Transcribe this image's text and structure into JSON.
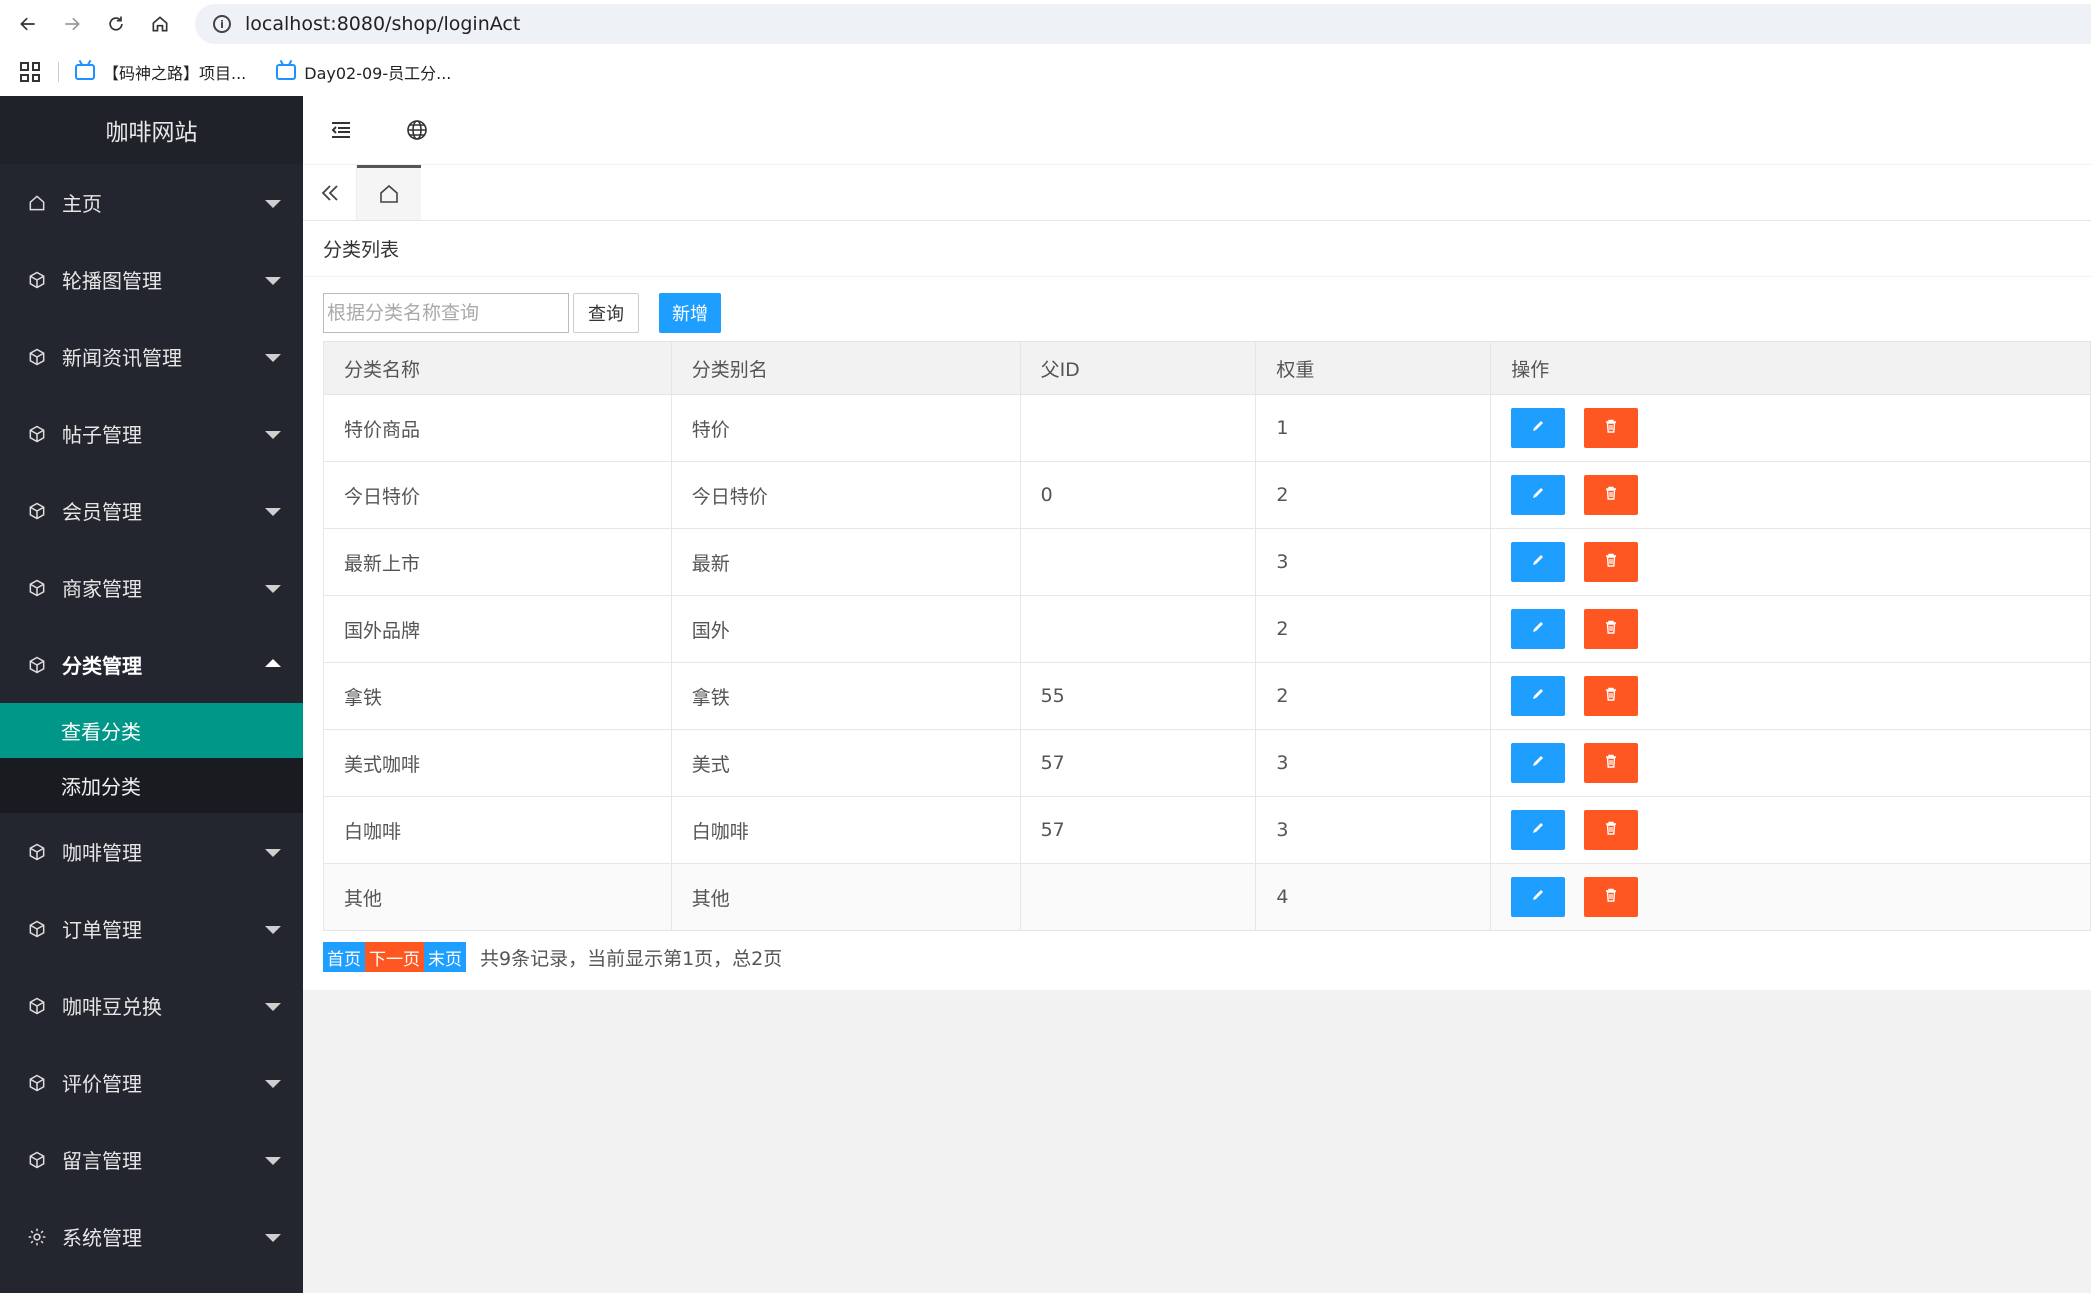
{
  "browser": {
    "url": "localhost:8080/shop/loginAct",
    "bookmarks": [
      "【码神之路】项目...",
      "Day02-09-员工分..."
    ]
  },
  "sidebar": {
    "logo": "咖啡网站",
    "items": [
      {
        "label": "主页",
        "icon": "home-icon"
      },
      {
        "label": "轮播图管理",
        "icon": "cube-icon"
      },
      {
        "label": "新闻资讯管理",
        "icon": "cube-icon"
      },
      {
        "label": "帖子管理",
        "icon": "cube-icon"
      },
      {
        "label": "会员管理",
        "icon": "cube-icon"
      },
      {
        "label": "商家管理",
        "icon": "cube-icon"
      },
      {
        "label": "分类管理",
        "icon": "cube-icon"
      },
      {
        "label": "咖啡管理",
        "icon": "cube-icon"
      },
      {
        "label": "订单管理",
        "icon": "cube-icon"
      },
      {
        "label": "咖啡豆兑换",
        "icon": "cube-icon"
      },
      {
        "label": "评价管理",
        "icon": "cube-icon"
      },
      {
        "label": "留言管理",
        "icon": "cube-icon"
      },
      {
        "label": "系统管理",
        "icon": "gear-icon"
      }
    ],
    "sub_items": [
      "查看分类",
      "添加分类"
    ]
  },
  "page": {
    "title": "分类列表",
    "search_placeholder": "根据分类名称查询",
    "query_label": "查询",
    "add_label": "新增"
  },
  "table": {
    "headers": [
      "分类名称",
      "分类别名",
      "父ID",
      "权重",
      "操作"
    ],
    "rows": [
      [
        "特价商品",
        "特价",
        "",
        "1"
      ],
      [
        "今日特价",
        "今日特价",
        "0",
        "2"
      ],
      [
        "最新上市",
        "最新",
        "",
        "3"
      ],
      [
        "国外品牌",
        "国外",
        "",
        "2"
      ],
      [
        "拿铁",
        "拿铁",
        "55",
        "2"
      ],
      [
        "美式咖啡",
        "美式",
        "57",
        "3"
      ],
      [
        "白咖啡",
        "白咖啡",
        "57",
        "3"
      ],
      [
        "其他",
        "其他",
        "",
        "4"
      ]
    ]
  },
  "pager": {
    "first": "首页",
    "next": "下一页",
    "last": "末页",
    "info": "共9条记录，当前显示第1页，总2页"
  },
  "colors": {
    "sidebar_bg": "#24262f",
    "active": "#009688",
    "primary": "#1e9fff",
    "danger": "#ff5722"
  }
}
